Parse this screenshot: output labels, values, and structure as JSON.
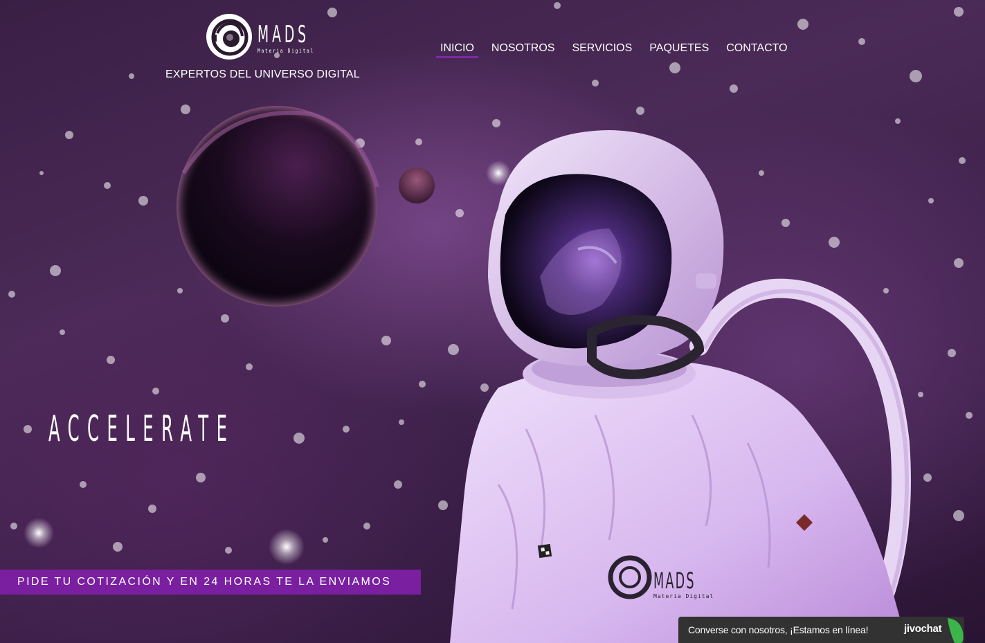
{
  "brand": {
    "name": "MADS",
    "subtitle": "Materia Digital",
    "tagline": "EXPERTOS DEL UNIVERSO DIGITAL"
  },
  "nav": {
    "items": [
      {
        "label": "INICIO",
        "active": true
      },
      {
        "label": "NOSOTROS",
        "active": false
      },
      {
        "label": "SERVICIOS",
        "active": false
      },
      {
        "label": "PAQUETES",
        "active": false
      },
      {
        "label": "CONTACTO",
        "active": false
      }
    ]
  },
  "hero": {
    "headline": "ACCELERATE",
    "cta": "PIDE TU COTIZACIÓN Y EN 24 HORAS TE LA ENVIAMOS",
    "suit_logo_name": "MADS",
    "suit_logo_sub": "Materia Digital"
  },
  "chat": {
    "message": "Converse con nosotros, ¡Estamos en línea!",
    "brand": "jivochat"
  },
  "colors": {
    "accent": "#7a1fa0",
    "chat_bg": "#323232",
    "chat_leaf": "#3bb54a"
  }
}
